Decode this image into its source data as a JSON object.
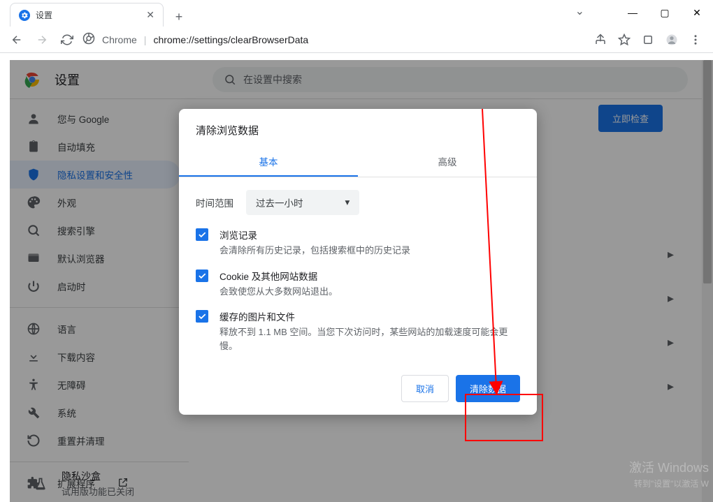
{
  "tab": {
    "title": "设置"
  },
  "url": {
    "site": "Chrome",
    "path": "chrome://settings/clearBrowserData"
  },
  "app": {
    "title": "设置",
    "search_placeholder": "在设置中搜索"
  },
  "sidebar": {
    "items": [
      {
        "label": "您与 Google"
      },
      {
        "label": "自动填充"
      },
      {
        "label": "隐私设置和安全性"
      },
      {
        "label": "外观"
      },
      {
        "label": "搜索引擎"
      },
      {
        "label": "默认浏览器"
      },
      {
        "label": "启动时"
      },
      {
        "label": "语言"
      },
      {
        "label": "下载内容"
      },
      {
        "label": "无障碍"
      },
      {
        "label": "系统"
      },
      {
        "label": "重置并清理"
      },
      {
        "label": "扩展程序"
      }
    ]
  },
  "check_button": "立即检查",
  "sandbox": {
    "title": "隐私沙盒",
    "sub": "试用版功能已关闭"
  },
  "dialog": {
    "title": "清除浏览数据",
    "tabs": {
      "basic": "基本",
      "advanced": "高级"
    },
    "time": {
      "label": "时间范围",
      "value": "过去一小时"
    },
    "opts": [
      {
        "title": "浏览记录",
        "desc": "会清除所有历史记录，包括搜索框中的历史记录"
      },
      {
        "title": "Cookie 及其他网站数据",
        "desc": "会致使您从大多数网站退出。"
      },
      {
        "title": "缓存的图片和文件",
        "desc": "释放不到 1.1 MB 空间。当您下次访问时，某些网站的加载速度可能会更慢。"
      }
    ],
    "cancel": "取消",
    "clear": "清除数据"
  },
  "watermark": {
    "line1": "激活 Windows",
    "line2": "转到\"设置\"以激活 W"
  }
}
